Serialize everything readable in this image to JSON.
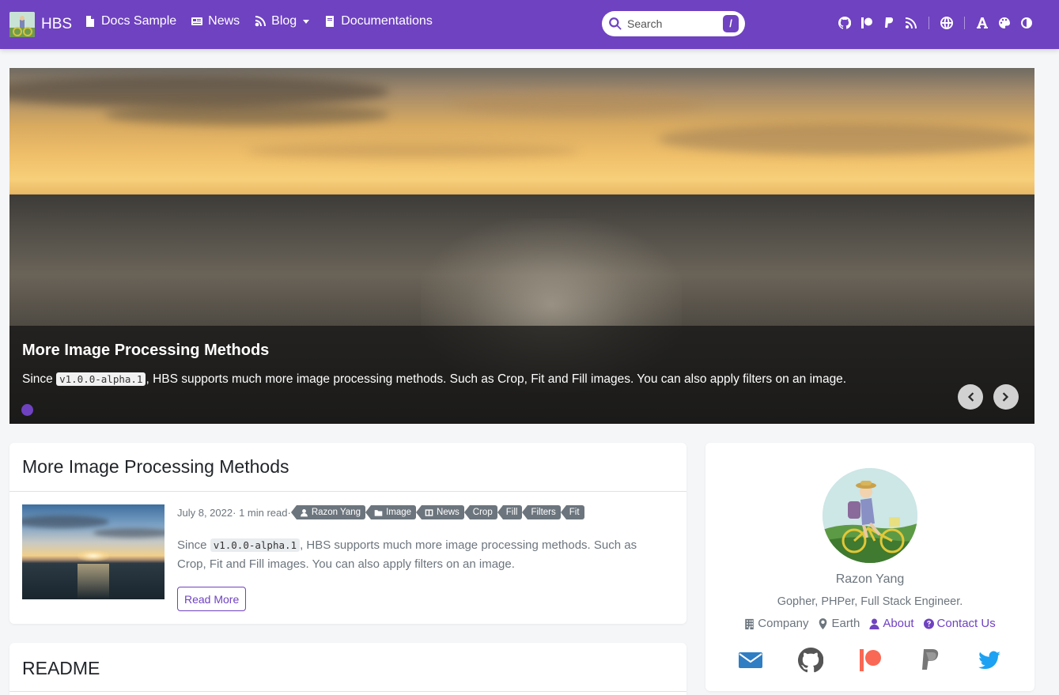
{
  "navbar": {
    "brand": "HBS",
    "links": [
      {
        "label": "Docs Sample",
        "icon": "file-icon"
      },
      {
        "label": "News",
        "icon": "newspaper-icon"
      },
      {
        "label": "Blog",
        "icon": "blog-icon",
        "dropdown": true
      },
      {
        "label": "Documentations",
        "icon": "book-icon"
      }
    ],
    "search": {
      "placeholder": "Search",
      "shortcut": "/"
    },
    "icons": [
      "github-icon",
      "patreon-icon",
      "paypal-icon",
      "rss-icon",
      "globe-icon",
      "font-icon",
      "palette-icon",
      "contrast-icon"
    ],
    "color": "#6f42c1"
  },
  "carousel": {
    "title": "More Image Processing Methods",
    "text_before": "Since ",
    "code": "v1.0.0-alpha.1",
    "text_after": ", HBS supports much more image processing methods. Such as Crop, Fit and Fill images. You can also apply filters on an image."
  },
  "post": {
    "title": "More Image Processing Methods",
    "date": "July 8, 2022",
    "read_time": "1 min read",
    "author": "Razon Yang",
    "categories": [
      "Image",
      "News"
    ],
    "tags": [
      "Crop",
      "Fill",
      "Filters",
      "Fit"
    ],
    "summary_before": "Since ",
    "summary_code": "v1.0.0-alpha.1",
    "summary_after": ", HBS supports much more image processing methods. Such as Crop, Fit and Fill images. You can also apply filters on an image.",
    "read_more": "Read More"
  },
  "readme": {
    "title": "README"
  },
  "profile": {
    "name": "Razon Yang",
    "bio": "Gopher, PHPer, Full Stack Engineer.",
    "company": "Company",
    "location": "Earth",
    "about": "About",
    "contact": "Contact Us",
    "socials": [
      {
        "icon": "email-icon",
        "color": "#2f7ec4"
      },
      {
        "icon": "github-icon",
        "color": "#555555"
      },
      {
        "icon": "patreon-icon",
        "color": "#f96854"
      },
      {
        "icon": "paypal-icon",
        "color": "#777777"
      },
      {
        "icon": "twitter-icon",
        "color": "#1da1f2"
      }
    ]
  }
}
